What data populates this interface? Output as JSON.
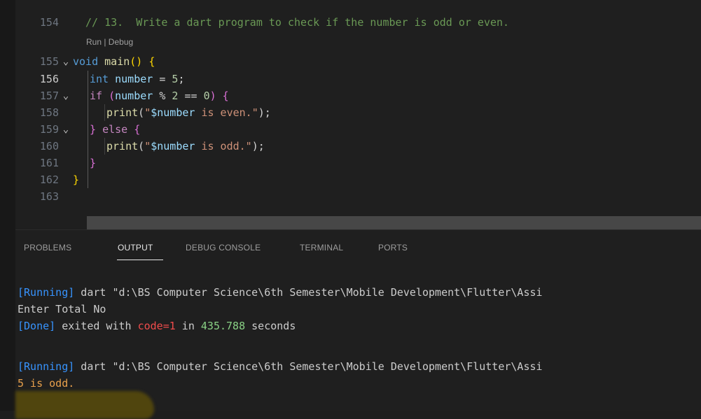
{
  "editor": {
    "code_lens": "Run | Debug",
    "lines": [
      {
        "num": "154",
        "text": "// 13.  Write a dart program to check if the number is odd or even."
      },
      {
        "num": "155",
        "text": "void main() {"
      },
      {
        "num": "156",
        "text": "int number = 5;"
      },
      {
        "num": "157",
        "text": "if (number % 2 == 0) {"
      },
      {
        "num": "158",
        "text": "print(\"$number is even.\");"
      },
      {
        "num": "159",
        "text": "} else {"
      },
      {
        "num": "160",
        "text": "print(\"$number is odd.\");"
      },
      {
        "num": "161",
        "text": "}"
      },
      {
        "num": "162",
        "text": "}"
      },
      {
        "num": "163",
        "text": ""
      }
    ]
  },
  "panel": {
    "tabs": [
      "PROBLEMS",
      "OUTPUT",
      "DEBUG CONSOLE",
      "TERMINAL",
      "PORTS"
    ],
    "active_tab": "OUTPUT",
    "output": {
      "run1_tag": "[Running]",
      "run1_cmd": " dart \"d:\\BS Computer Science\\6th Semester\\Mobile Development\\Flutter\\Assi",
      "prompt": "Enter Total No",
      "done_tag": "[Done]",
      "done_text1": " exited with ",
      "done_code": "code=1",
      "done_text2": " in ",
      "done_secs": "435.788",
      "done_text3": " seconds",
      "run2_tag": "[Running]",
      "run2_cmd": " dart \"d:\\BS Computer Science\\6th Semester\\Mobile Development\\Flutter\\Assi",
      "result": "5 is odd."
    }
  },
  "colors": {
    "background": "#1e1e1e",
    "keyword": "#569cd6",
    "string": "#ce9178",
    "comment": "#6a9955",
    "output_blue": "#3794ff"
  }
}
